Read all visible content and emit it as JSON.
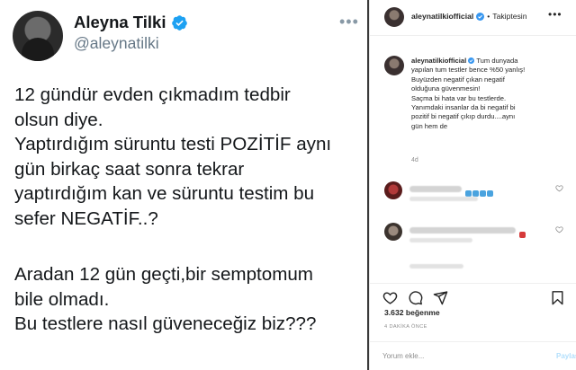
{
  "tweet": {
    "name": "Aleyna Tilki",
    "handle": "@aleynatilki",
    "more_icon": "more-horizontal-icon",
    "paragraphs": [
      [
        "12 gündür evden çıkmadım tedbir",
        "olsun diye.",
        "Yaptırdığım süruntu testi POZİTİF aynı",
        "gün birkaç saat sonra tekrar",
        "yaptırdığım kan ve süruntu testim bu",
        "sefer NEGATİF..?"
      ],
      [
        "Aradan 12 gün geçti,bir semptomum",
        "bile olmadı.",
        "Bu testlere nasıl güveneceğiz biz???"
      ]
    ],
    "verified_color": "#1da1f2"
  },
  "instagram": {
    "header": {
      "username": "aleynatilkiofficial",
      "separator": "•",
      "follow_label": "Takiptesin"
    },
    "caption": {
      "username": "aleynatilkiofficial",
      "lines": [
        "Tum dunyada",
        "yapılan tum testler bence %50 yanlış!",
        "Buyüzden negatif çıkan negatif",
        "olduğuna güvenmesin!",
        "Saçma bi hata var bu testlerde.",
        "Yanımdaki insanlar da bi negatif bi",
        "pozitif bi negatif çıkıp durdu....aynı",
        "gün hem de"
      ],
      "age": "4d"
    },
    "likes": "3.632 beğenme",
    "time": "4 DAKİKA ÖNCE",
    "comment_placeholder": "Yorum ekle...",
    "share_label": "Paylaş",
    "colors": {
      "verified": "#3897f0",
      "share": "#b2dffc",
      "secondary_text": "#8e8e8e"
    }
  }
}
